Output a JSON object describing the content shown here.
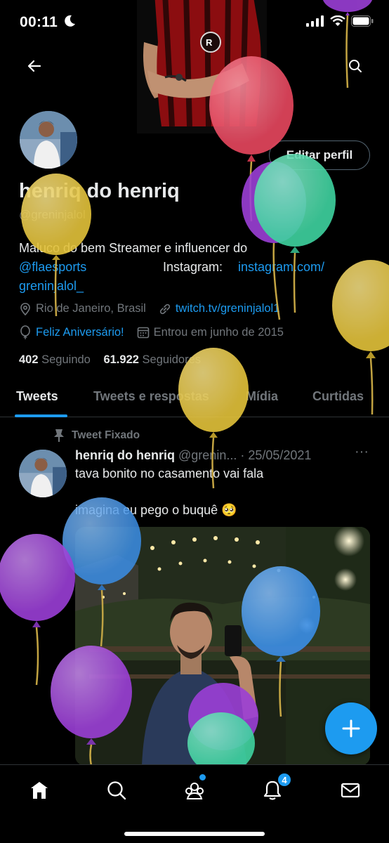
{
  "status_bar": {
    "time": "00:11"
  },
  "profile": {
    "edit_label": "Editar perfil",
    "name": "henriq do henriq",
    "handle": "@greninjalol",
    "bio": {
      "line1": "Maluco do bem Streamer e influencer do",
      "mention": "@flaesports",
      "instagram_label": "Instagram:",
      "instagram_link_a": "instagram.com/",
      "instagram_link_b": "greninjalol_"
    },
    "location": "Rio de Janeiro, Brasil",
    "website": "twitch.tv/greninjalol1",
    "birthday": "Feliz Aniversário!",
    "joined": "Entrou em junho de 2015",
    "following_count": "402",
    "following_label": "Seguindo",
    "followers_count": "61.922",
    "followers_label": "Seguidores"
  },
  "tabs": [
    {
      "label": "Tweets",
      "active": true
    },
    {
      "label": "Tweets e respostas",
      "active": false
    },
    {
      "label": "Mídia",
      "active": false
    },
    {
      "label": "Curtidas",
      "active": false
    }
  ],
  "pinned_tweet": {
    "pinned_label": "Tweet Fixado",
    "author_name": "henriq do henriq",
    "author_handle": "@grenin...",
    "separator": "·",
    "date": "25/05/2021",
    "more": "···",
    "text_line1": "tava bonito no casamento vai fala",
    "text_line2": "imagina eu pego o buquê 🥺"
  },
  "bottom_nav": {
    "items": [
      "home-icon",
      "search-icon",
      "communities-icon",
      "notifications-icon",
      "messages-icon"
    ],
    "notifications_badge": "4"
  },
  "colors": {
    "accent": "#1d9bf0",
    "background": "#000000",
    "text_primary": "#e7e9ea",
    "text_secondary": "#71767b",
    "balloon_red": "#e8475f",
    "balloon_yellow": "#e3c23a",
    "balloon_green": "#3fd3a0",
    "balloon_purple": "#9b3fd6",
    "balloon_blue": "#3b8ee6"
  }
}
